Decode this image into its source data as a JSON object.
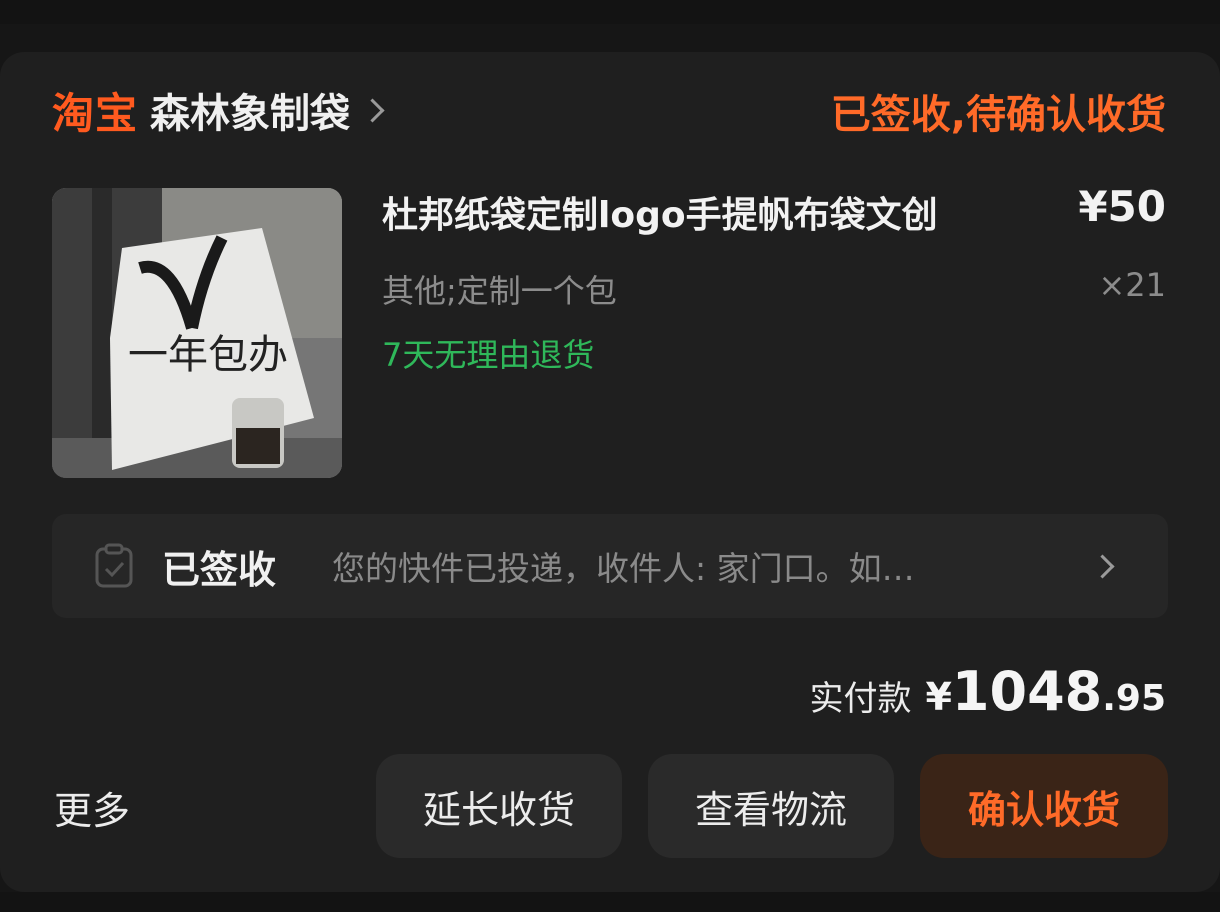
{
  "shop": {
    "platform_label": "淘宝",
    "name": "森林象制袋"
  },
  "order": {
    "status": "已签收,待确认收货"
  },
  "product": {
    "title": "杜邦纸袋定制logo手提帆布袋文创",
    "price": "¥50",
    "spec": "其他;定制一个包",
    "quantity": "×21",
    "tag": "7天无理由退货",
    "image_text": "一年包办"
  },
  "logistics": {
    "status": "已签收",
    "desc": "您的快件已投递，收件人: 家门口。如…"
  },
  "payment": {
    "label": "实付款",
    "symbol": "¥",
    "integer": "1048",
    "decimal": ".95"
  },
  "actions": {
    "more": "更多",
    "extend": "延长收货",
    "track": "查看物流",
    "confirm": "确认收货"
  },
  "colors": {
    "accent": "#ff6a28",
    "green": "#2fb85a",
    "background": "#1f1f1f"
  }
}
